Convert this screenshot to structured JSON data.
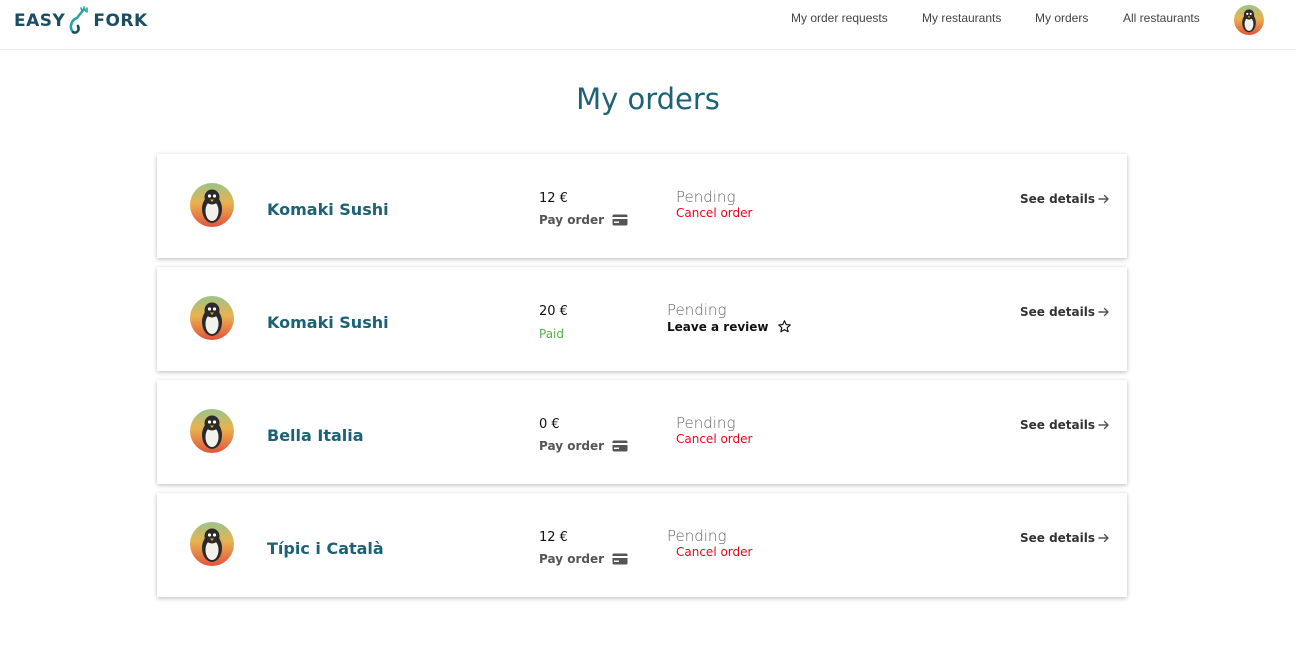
{
  "app": {
    "logo_left": "EASY",
    "logo_right": "FORK"
  },
  "nav": {
    "items": [
      {
        "label": "My order requests"
      },
      {
        "label": "My restaurants"
      },
      {
        "label": "My orders"
      },
      {
        "label": "All restaurants"
      }
    ],
    "avatar_icon": "penguin-avatar"
  },
  "page": {
    "title": "My orders"
  },
  "orders": [
    {
      "restaurant": "Komaki Sushi",
      "price": "12 €",
      "payment_label": "Pay order",
      "payment_icon": "credit-card-icon",
      "status": "Pending",
      "action_label": "Cancel order",
      "details_label": "See details"
    },
    {
      "restaurant": "Komaki Sushi",
      "price": "20 €",
      "payment_label": "Paid",
      "status": "Pending",
      "action_label": "Leave a review",
      "action_icon": "star-outline-icon",
      "details_label": "See details"
    },
    {
      "restaurant": "Bella Italia",
      "price": "0 €",
      "payment_label": "Pay order",
      "payment_icon": "credit-card-icon",
      "status": "Pending",
      "action_label": "Cancel order",
      "details_label": "See details"
    },
    {
      "restaurant": "Típic i Català",
      "price": "12 €",
      "payment_label": "Pay order",
      "payment_icon": "credit-card-icon",
      "status": "Pending",
      "action_label": "Cancel order",
      "details_label": "See details"
    }
  ],
  "colors": {
    "brand": "#1c4e63",
    "title": "#1d6276",
    "cancel": "#e3091e",
    "paid": "#52b24a"
  }
}
